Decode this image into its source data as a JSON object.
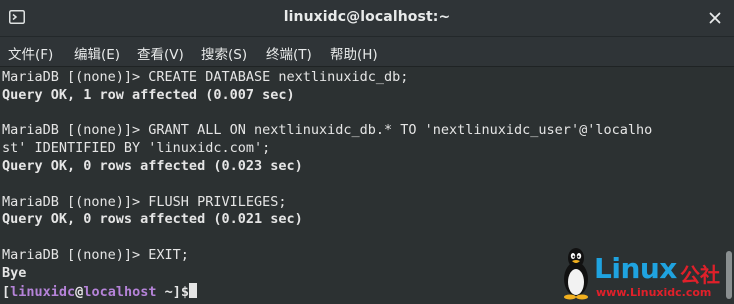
{
  "window": {
    "title": "linuxidc@localhost:~"
  },
  "menu": {
    "items": [
      "文件(F)",
      "编辑(E)",
      "查看(V)",
      "搜索(S)",
      "终端(T)",
      "帮助(H)"
    ]
  },
  "terminal": {
    "lines": [
      {
        "text": "MariaDB [(none)]> CREATE DATABASE nextlinuxidc_db;",
        "bold": false
      },
      {
        "text": "Query OK, 1 row affected (0.007 sec)",
        "bold": true
      },
      {
        "text": "",
        "bold": false
      },
      {
        "text": "MariaDB [(none)]> GRANT ALL ON nextlinuxidc_db.* TO 'nextlinuxidc_user'@'localho",
        "bold": false
      },
      {
        "text": "st' IDENTIFIED BY 'linuxidc.com';",
        "bold": false
      },
      {
        "text": "Query OK, 0 rows affected (0.023 sec)",
        "bold": true
      },
      {
        "text": "",
        "bold": false
      },
      {
        "text": "MariaDB [(none)]> FLUSH PRIVILEGES;",
        "bold": false
      },
      {
        "text": "Query OK, 0 rows affected (0.021 sec)",
        "bold": true
      },
      {
        "text": "",
        "bold": false
      },
      {
        "text": "MariaDB [(none)]> EXIT;",
        "bold": false
      },
      {
        "text": "Bye",
        "bold": true
      }
    ],
    "prompt": {
      "open": "[",
      "user": "linuxidc",
      "at": "@",
      "host": "localhost",
      "dir": " ~",
      "close": "]$"
    }
  },
  "watermark": {
    "logo": "Linux",
    "logo_cn": "公社",
    "url": "www.Linuxidc.com"
  },
  "colors": {
    "background": "#2c3132",
    "text": "#e5e5e5",
    "prompt_user": "#b583d8",
    "logo_blue": "#1fa3e0",
    "logo_red": "#e0202a"
  }
}
